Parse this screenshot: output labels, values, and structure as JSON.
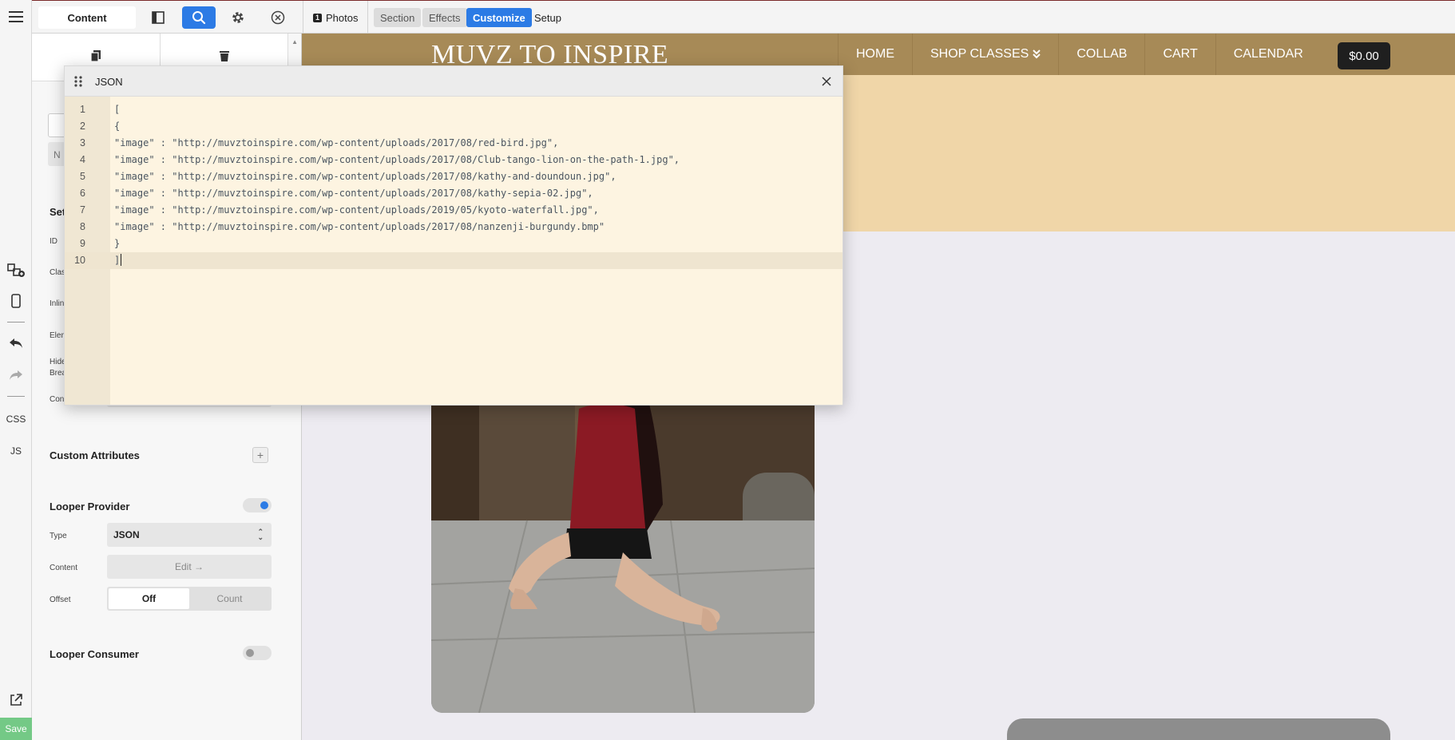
{
  "topbar": {
    "content_label": "Content",
    "breadcrumb": {
      "badge": "1",
      "label": "Photos"
    },
    "tabs": [
      {
        "label": "Section",
        "active": false
      },
      {
        "label": "Effects",
        "active": false
      },
      {
        "label": "Customize",
        "active": true
      },
      {
        "label": "Setup",
        "active": false
      }
    ],
    "accent": "#2c7be5"
  },
  "rail": {
    "css_label": "CSS",
    "js_label": "JS",
    "save_label": "Save"
  },
  "panel": {
    "partial_labels": {
      "n_fragment": "N",
      "settings_fragment": "Set",
      "id": "ID",
      "class_fragment": "Clas",
      "inline_fragment": "Inlin",
      "element_fragment": "Elem",
      "hide_fragment": "Hide",
      "breakpoint_fragment": "Brea",
      "conditions_fragment": "Con"
    },
    "custom_attributes": {
      "title": "Custom Attributes"
    },
    "looper_provider": {
      "title": "Looper Provider",
      "enabled": true,
      "type_label": "Type",
      "type_value": "JSON",
      "content_label": "Content",
      "content_button": "Edit →",
      "offset_label": "Offset",
      "offset_options": [
        "Off",
        "Count"
      ],
      "offset_selected": "Off"
    },
    "looper_consumer": {
      "title": "Looper Consumer",
      "enabled": false
    }
  },
  "site": {
    "logo": "MUVZ TO INSPIRE",
    "nav": [
      "HOME",
      "SHOP CLASSES",
      "COLLAB",
      "CART",
      "CALENDAR"
    ],
    "cart_total": "$0.00",
    "colors": {
      "nav": "#a78a57",
      "band": "#f0d6a8",
      "background": "#edebf1"
    }
  },
  "modal": {
    "title": "JSON",
    "lines": [
      {
        "n": "1",
        "text": "["
      },
      {
        "n": "2",
        "text": "{"
      },
      {
        "n": "3",
        "text": "\"image\" : \"http://muvztoinspire.com/wp-content/uploads/2017/08/red-bird.jpg\","
      },
      {
        "n": "4",
        "text": "\"image\" : \"http://muvztoinspire.com/wp-content/uploads/2017/08/Club-tango-lion-on-the-path-1.jpg\","
      },
      {
        "n": "5",
        "text": "\"image\" : \"http://muvztoinspire.com/wp-content/uploads/2017/08/kathy-and-doundoun.jpg\","
      },
      {
        "n": "6",
        "text": "\"image\" : \"http://muvztoinspire.com/wp-content/uploads/2017/08/kathy-sepia-02.jpg\","
      },
      {
        "n": "7",
        "text": "\"image\" : \"http://muvztoinspire.com/wp-content/uploads/2019/05/kyoto-waterfall.jpg\","
      },
      {
        "n": "8",
        "text": "\"image\" : \"http://muvztoinspire.com/wp-content/uploads/2017/08/nanzenji-burgundy.bmp\""
      },
      {
        "n": "9",
        "text": "}"
      },
      {
        "n": "10",
        "text": "]"
      }
    ],
    "current_line": "10"
  }
}
